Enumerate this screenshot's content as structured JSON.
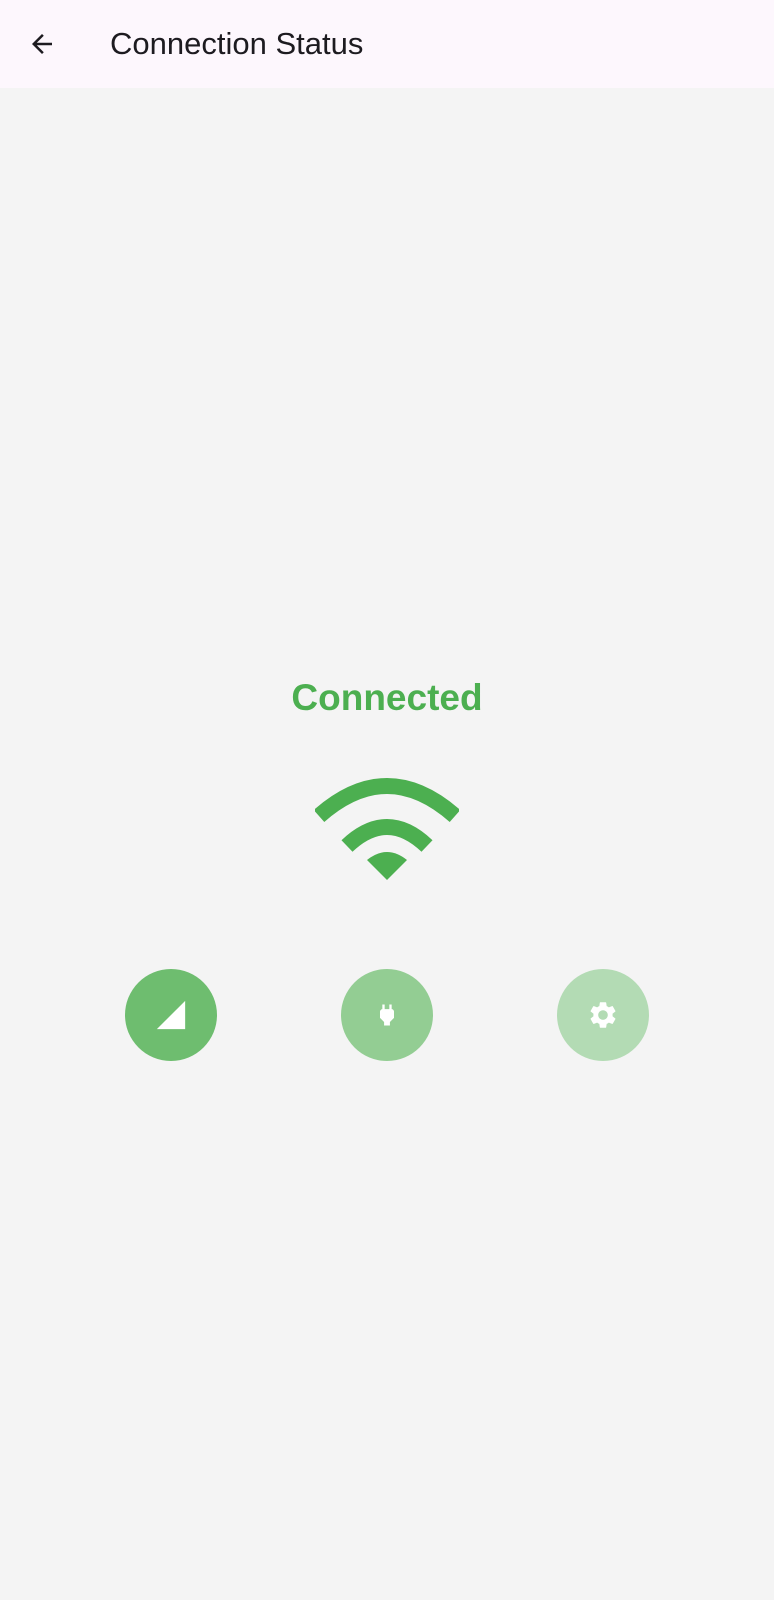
{
  "app_bar": {
    "title": "Connection Status",
    "back_icon": "arrow-back-icon"
  },
  "status": {
    "label": "Connected",
    "color": "#4caf50",
    "icon": "wifi-icon"
  },
  "actions": [
    {
      "icon": "signal-cellular-icon",
      "color": "#6ebd6f"
    },
    {
      "icon": "power-plug-icon",
      "color": "#93cd93"
    },
    {
      "icon": "settings-gear-icon",
      "color": "#b3dbb4"
    }
  ],
  "colors": {
    "app_bar_bg": "#fdf7fd",
    "page_bg": "#f4f4f4",
    "title_text": "#1d1b20"
  }
}
